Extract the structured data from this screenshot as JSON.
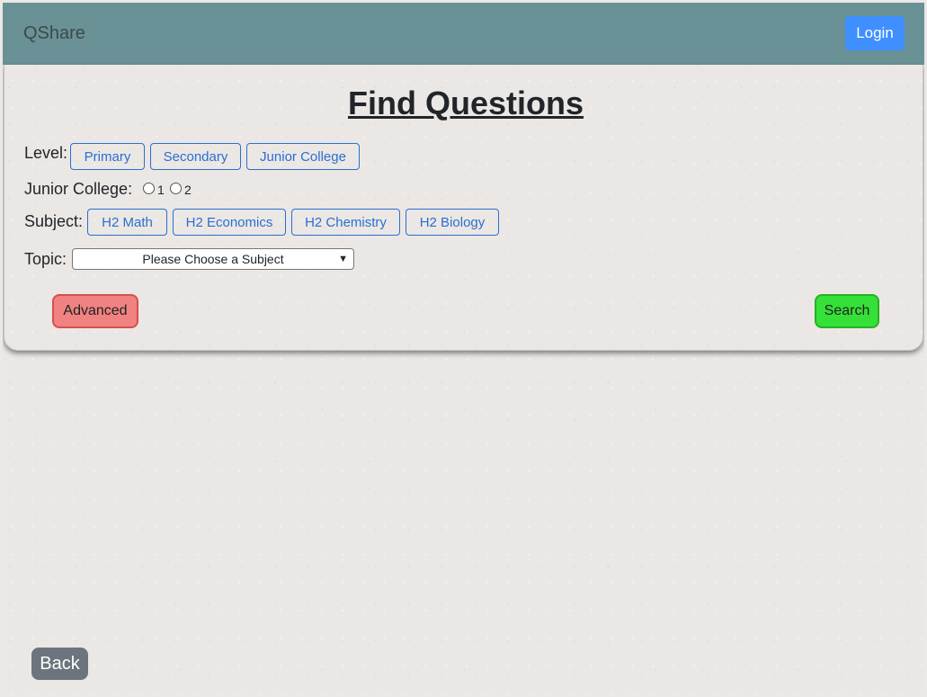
{
  "navbar": {
    "brand": "QShare",
    "login_label": "Login"
  },
  "panel": {
    "title": "Find Questions",
    "level": {
      "label": "Level:",
      "options": [
        "Primary",
        "Secondary",
        "Junior College"
      ]
    },
    "junior_college": {
      "label": "Junior College:",
      "radios": [
        "1",
        "2"
      ]
    },
    "subject": {
      "label": "Subject:",
      "options": [
        "H2 Math",
        "H2 Economics",
        "H2 Chemistry",
        "H2 Biology"
      ]
    },
    "topic": {
      "label": "Topic:",
      "selected": "Please Choose a Subject"
    },
    "advanced_label": "Advanced",
    "search_label": "Search"
  },
  "back_label": "Back",
  "colors": {
    "navbar": "#6a9196",
    "login": "#3f8fff",
    "advanced": "#f08282",
    "search": "#35e038",
    "back": "#6c757d",
    "option_border": "#2a6fd1"
  },
  "icons": {
    "select_arrow": "chevron-down-icon"
  }
}
